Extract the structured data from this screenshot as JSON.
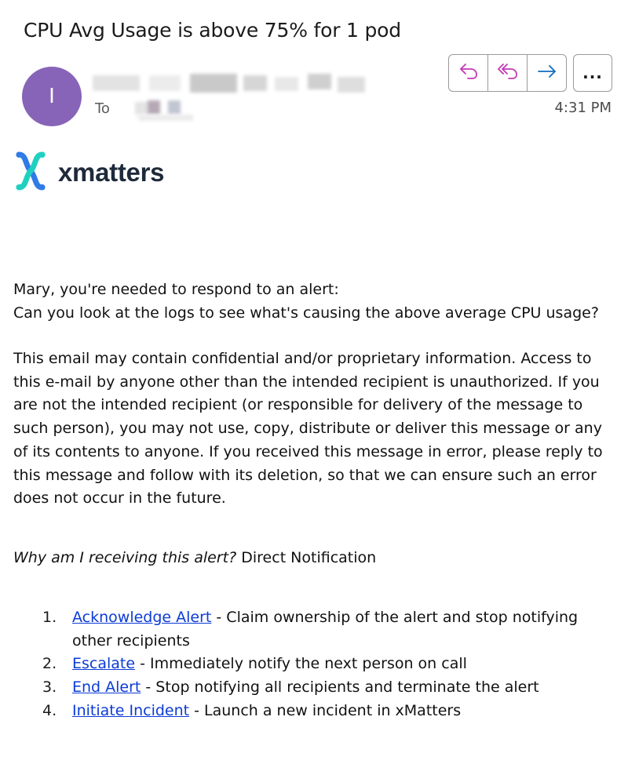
{
  "email": {
    "subject": "CPU Avg Usage is above 75% for 1 pod",
    "avatar_initial": "I",
    "to_label": "To",
    "timestamp": "4:31 PM"
  },
  "toolbar": {
    "reply_icon": "reply-icon",
    "reply_all_icon": "reply-all-icon",
    "forward_icon": "forward-icon",
    "more_label": "..."
  },
  "logo": {
    "text": "xmatters",
    "colors": {
      "blue": "#2f7ce6",
      "teal": "#1fd0c0",
      "text": "#1e2a3a"
    }
  },
  "message": {
    "greeting_line1": "Mary, you're needed to respond to an alert:",
    "greeting_line2": "Can you look at the logs to see what's causing the above average CPU usage?",
    "disclaimer": "This email may contain confidential and/or proprietary information. Access to this e-mail by anyone other than the intended recipient is unauthorized. If you are not the intended recipient (or responsible for delivery of the message to such person), you may not use, copy, distribute or deliver this message or any of its contents to anyone. If you received this message in error, please reply to this message and follow with its deletion, so that we can ensure such an error does not occur in the future.",
    "why_question": "Why am I receiving this alert?",
    "why_answer": "Direct Notification"
  },
  "actions": [
    {
      "number": "1.",
      "link": "Acknowledge Alert",
      "description": " - Claim ownership of the alert and stop notifying other recipients"
    },
    {
      "number": "2.",
      "link": "Escalate",
      "description": " - Immediately notify the next person on call"
    },
    {
      "number": "3.",
      "link": "End Alert",
      "description": " - Stop notifying all recipients and terminate the alert"
    },
    {
      "number": "4.",
      "link": "Initiate Incident",
      "description": " - Launch a new incident in xMatters"
    }
  ],
  "colors": {
    "avatar": "#8764b8",
    "reply_icon": "#c239b3",
    "forward_icon": "#0f6cbd",
    "link": "#0b3bd6"
  }
}
